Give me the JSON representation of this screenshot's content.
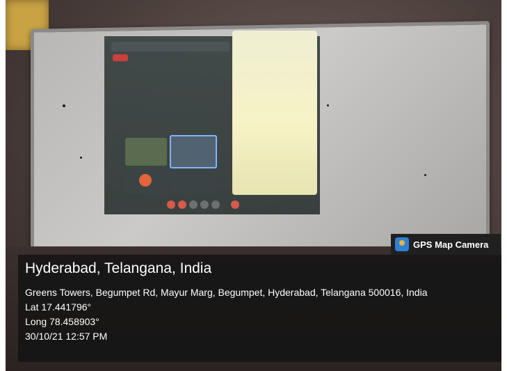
{
  "badge": {
    "icon": "map-pin-icon",
    "label": "GPS Map Camera"
  },
  "location": {
    "city": "Hyderabad, Telangana, India",
    "address": "Greens Towers, Begumpet Rd, Mayur Marg, Begumpet, Hyderabad, Telangana 500016, India",
    "lat": "Lat 17.441796°",
    "long": "Long 78.458903°",
    "datetime": "30/10/21 12:57 PM"
  },
  "photo_colors": {
    "overlay": "#141414",
    "badge": "#202020",
    "accent": "#2f80d6"
  }
}
